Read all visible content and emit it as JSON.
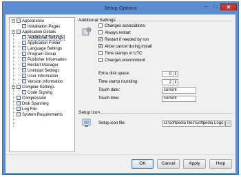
{
  "window": {
    "title": "Setup Options",
    "minimize_glyph": "–",
    "maximize_glyph": "□",
    "close_glyph": "✕"
  },
  "tree": {
    "items": [
      {
        "label": "Appearance",
        "icon": "appearance-icon"
      },
      {
        "label": "Installation Pages",
        "icon": "page-icon"
      },
      {
        "label": "Application Details",
        "icon": "application-icon"
      },
      {
        "label": "Additional Settings",
        "icon": "settings-icon",
        "selected": true
      },
      {
        "label": "Application Folder",
        "icon": "folder-icon"
      },
      {
        "label": "Language Settings",
        "icon": "language-icon"
      },
      {
        "label": "Program Group",
        "icon": "program-group-icon"
      },
      {
        "label": "Publisher Information",
        "icon": "publisher-icon"
      },
      {
        "label": "Restart Manager",
        "icon": "restart-icon"
      },
      {
        "label": "Uninstall Settings",
        "icon": "uninstall-icon"
      },
      {
        "label": "User Information",
        "icon": "user-icon"
      },
      {
        "label": "Version Information",
        "icon": "version-icon"
      },
      {
        "label": "Compiler Settings",
        "icon": "compiler-icon"
      },
      {
        "label": "Code Signing",
        "icon": "signing-icon"
      },
      {
        "label": "Compression",
        "icon": "compression-icon"
      },
      {
        "label": "Disk Spanning",
        "icon": "disk-icon"
      },
      {
        "label": "Log File",
        "icon": "log-icon"
      },
      {
        "label": "System Requirements",
        "icon": "system-icon"
      }
    ]
  },
  "additional": {
    "title": "Additional Settings",
    "checkboxes": [
      {
        "label": "Changes associations",
        "checked": false
      },
      {
        "label": "Always restart",
        "checked": false
      },
      {
        "label": "Restart if needed by run",
        "checked": true
      },
      {
        "label": "Allow cancel during install",
        "checked": true
      },
      {
        "label": "Time stamps in UTC",
        "checked": false
      },
      {
        "label": "Changes environment",
        "checked": false
      }
    ],
    "extra_disk_label": "Extra disk space:",
    "extra_disk_value": "0",
    "timestamp_label": "Time stamp rounding:",
    "timestamp_value": "2",
    "touch_date_label": "Touch date:",
    "touch_date_value": "current",
    "touch_time_label": "Touch time:",
    "touch_time_value": "current"
  },
  "setup_icon": {
    "title": "Setup Icon",
    "file_label": "Setup icon file:",
    "file_value": "D:\\softpedia files\\Softpedia Logo.ico",
    "browse_label": "..."
  },
  "buttons": {
    "ok": "OK",
    "cancel": "Cancel",
    "apply": "Apply",
    "help": "Help"
  }
}
